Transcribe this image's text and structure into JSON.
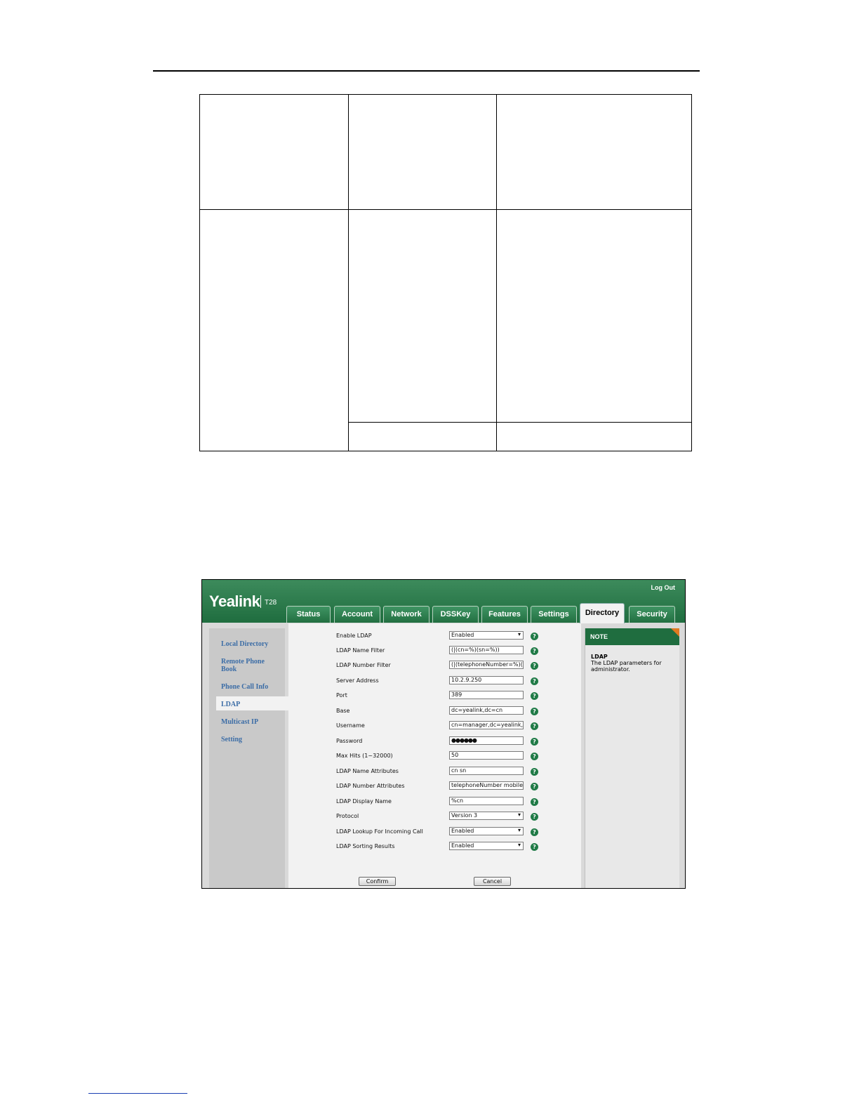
{
  "ui": {
    "logo": "Yealink",
    "model": "T28",
    "logout": "Log Out",
    "tabs": [
      "Status",
      "Account",
      "Network",
      "DSSKey",
      "Features",
      "Settings",
      "Directory",
      "Security"
    ],
    "active_tab": "Directory",
    "nav": [
      "Local Directory",
      "Remote Phone Book",
      "Phone Call Info",
      "LDAP",
      "Multicast IP",
      "Setting"
    ],
    "active_nav": "LDAP",
    "fields": [
      {
        "label": "Enable LDAP",
        "value": "Enabled",
        "type": "select"
      },
      {
        "label": "LDAP Name Filter",
        "value": "(|(cn=%)(sn=%))",
        "type": "text"
      },
      {
        "label": "LDAP Number Filter",
        "value": "(|(telephoneNumber=%)(m",
        "type": "text"
      },
      {
        "label": "Server Address",
        "value": "10.2.9.250",
        "type": "text"
      },
      {
        "label": "Port",
        "value": "389",
        "type": "text"
      },
      {
        "label": "Base",
        "value": "dc=yealink,dc=cn",
        "type": "text"
      },
      {
        "label": "Username",
        "value": "cn=manager,dc=yealink,dc=",
        "type": "text"
      },
      {
        "label": "Password",
        "value": "●●●●●●",
        "type": "password"
      },
      {
        "label": "Max Hits (1~32000)",
        "value": "50",
        "type": "text"
      },
      {
        "label": "LDAP Name Attributes",
        "value": "cn sn",
        "type": "text"
      },
      {
        "label": "LDAP Number Attributes",
        "value": "telephoneNumber mobile ip",
        "type": "text"
      },
      {
        "label": "LDAP Display Name",
        "value": "%cn",
        "type": "text"
      },
      {
        "label": "Protocol",
        "value": "Version 3",
        "type": "select"
      },
      {
        "label": "LDAP Lookup For Incoming Call",
        "value": "Enabled",
        "type": "select"
      },
      {
        "label": "LDAP Sorting Results",
        "value": "Enabled",
        "type": "select"
      }
    ],
    "confirm": "Confirm",
    "cancel": "Cancel",
    "note": {
      "header": "NOTE",
      "title": "LDAP",
      "text": "The LDAP parameters for administrator."
    }
  },
  "colors": {
    "brand_green": "#1f6d3f",
    "nav_link": "#3c6da6",
    "note_corner": "#e07a20"
  }
}
